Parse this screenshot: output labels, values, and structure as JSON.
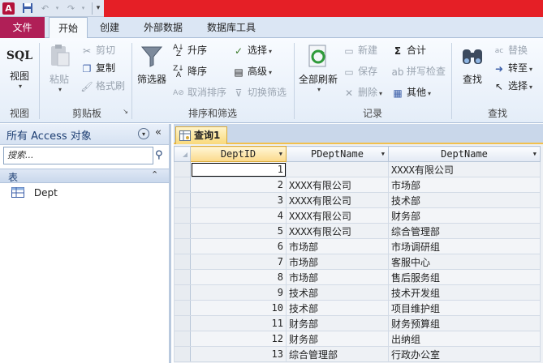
{
  "quick_access": {
    "app_icon": "access-app-icon",
    "save_icon": "save-icon",
    "undo_icon": "undo-icon",
    "redo_icon": "redo-icon",
    "customize_icon": "customize-qat-icon"
  },
  "tabs": [
    {
      "label": "文件"
    },
    {
      "label": "开始"
    },
    {
      "label": "创建"
    },
    {
      "label": "外部数据"
    },
    {
      "label": "数据库工具"
    }
  ],
  "ribbon": {
    "views": {
      "sql": "SQL",
      "view": "视图",
      "group": "视图"
    },
    "clipboard": {
      "paste": "粘贴",
      "cut": "剪切",
      "copy": "复制",
      "format_painter": "格式刷",
      "group": "剪贴板"
    },
    "sort_filter": {
      "filter": "筛选器",
      "ascending": "升序",
      "descending": "降序",
      "remove_sort": "取消排序",
      "selection": "选择",
      "advanced": "高级",
      "toggle_filter": "切换筛选",
      "group": "排序和筛选"
    },
    "records": {
      "refresh_all": "全部刷新",
      "new": "新建",
      "save": "保存",
      "delete": "删除",
      "totals": "合计",
      "spelling": "拼写检查",
      "more": "其他",
      "group": "记录"
    },
    "find": {
      "find": "查找",
      "replace": "替换",
      "goto": "转至",
      "select": "选择",
      "group": "查找"
    }
  },
  "nav_pane": {
    "title": "所有 Access 对象",
    "search_placeholder": "搜索...",
    "category": "表",
    "items": [
      {
        "label": "Dept"
      }
    ]
  },
  "document": {
    "tab_label": "查询1",
    "columns": [
      "DeptID",
      "PDeptName",
      "DeptName"
    ],
    "rows": [
      {
        "id": "1",
        "pname": "",
        "name": "XXXX有限公司"
      },
      {
        "id": "2",
        "pname": "XXXX有限公司",
        "name": "市场部"
      },
      {
        "id": "3",
        "pname": "XXXX有限公司",
        "name": "技术部"
      },
      {
        "id": "4",
        "pname": "XXXX有限公司",
        "name": "财务部"
      },
      {
        "id": "5",
        "pname": "XXXX有限公司",
        "name": "综合管理部"
      },
      {
        "id": "6",
        "pname": "市场部",
        "name": "市场调研组"
      },
      {
        "id": "7",
        "pname": "市场部",
        "name": "客服中心"
      },
      {
        "id": "8",
        "pname": "市场部",
        "name": "售后服务组"
      },
      {
        "id": "9",
        "pname": "技术部",
        "name": "技术开发组"
      },
      {
        "id": "10",
        "pname": "技术部",
        "name": "项目维护组"
      },
      {
        "id": "11",
        "pname": "财务部",
        "name": "财务预算组"
      },
      {
        "id": "12",
        "pname": "财务部",
        "name": "出纳组"
      },
      {
        "id": "13",
        "pname": "综合管理部",
        "name": "行政办公室"
      }
    ]
  },
  "colors": {
    "titlebar": "#e51f26",
    "file_tab": "#b01f57",
    "active_doc_tab": "#f9d97a"
  }
}
